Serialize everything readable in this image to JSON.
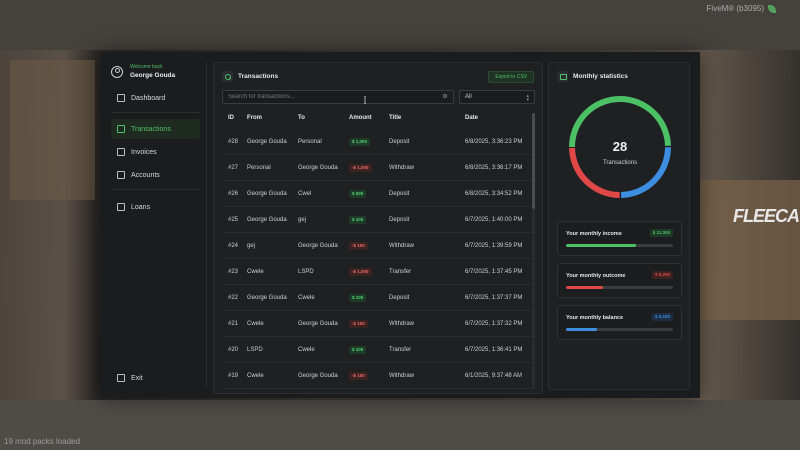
{
  "overlay": {
    "top_right": "FiveM® (b3095)",
    "bottom_left": "19 mod packs loaded",
    "fleeca_logo": "FLEECA"
  },
  "user": {
    "welcome": "Welcome back",
    "name": "George Gouda"
  },
  "nav": {
    "dashboard": "Dashboard",
    "transactions": "Transactions",
    "invoices": "Invoices",
    "accounts": "Accounts",
    "loans": "Loans",
    "exit": "Exit"
  },
  "transactions": {
    "title": "Transactions",
    "export_label": "Export to CSV",
    "search_placeholder": "Search for transactions...",
    "filter_value": "All",
    "columns": [
      "ID",
      "From",
      "To",
      "Amount",
      "Title",
      "Date"
    ],
    "rows": [
      {
        "id": "#28",
        "from": "George Gouda",
        "to": "Personal",
        "amount": "$ 1,000",
        "type": "pos",
        "title": "Deposit",
        "date": "6/8/2025, 3:36:23 PM"
      },
      {
        "id": "#27",
        "from": "Personal",
        "to": "George Gouda",
        "amount": "-$ 1,000",
        "type": "neg",
        "title": "Withdraw",
        "date": "6/8/2025, 3:36:17 PM"
      },
      {
        "id": "#26",
        "from": "George Gouda",
        "to": "Cwel",
        "amount": "$ 500",
        "type": "pos",
        "title": "Deposit",
        "date": "6/8/2025, 3:34:52 PM"
      },
      {
        "id": "#25",
        "from": "George Gouda",
        "to": "gej",
        "amount": "$ 100",
        "type": "pos",
        "title": "Deposit",
        "date": "6/7/2025, 1:40:00 PM"
      },
      {
        "id": "#24",
        "from": "gej",
        "to": "George Gouda",
        "amount": "-$ 100",
        "type": "neg",
        "title": "Withdraw",
        "date": "6/7/2025, 1:39:59 PM"
      },
      {
        "id": "#23",
        "from": "Cwele",
        "to": "LSPD",
        "amount": "-$ 1,000",
        "type": "neg",
        "title": "Transfer",
        "date": "6/7/2025, 1:37:45 PM"
      },
      {
        "id": "#22",
        "from": "George Gouda",
        "to": "Cwele",
        "amount": "$ 100",
        "type": "pos",
        "title": "Deposit",
        "date": "6/7/2025, 1:37:37 PM"
      },
      {
        "id": "#21",
        "from": "Cwele",
        "to": "George Gouda",
        "amount": "-$ 100",
        "type": "neg",
        "title": "Withdraw",
        "date": "6/7/2025, 1:37:32 PM"
      },
      {
        "id": "#20",
        "from": "LSPD",
        "to": "Cwele",
        "amount": "$ 100",
        "type": "pos",
        "title": "Transfer",
        "date": "6/7/2025, 1:36:41 PM"
      },
      {
        "id": "#19",
        "from": "Cwele",
        "to": "George Gouda",
        "amount": "-$ 100",
        "type": "neg",
        "title": "Withdraw",
        "date": "6/1/2025, 9:37:48 AM"
      }
    ]
  },
  "stats": {
    "title": "Monthly statistics",
    "count": "28",
    "count_label": "Transactions",
    "donut_segments": [
      {
        "fraction": 0.5,
        "color": "#4cc064"
      },
      {
        "fraction": 0.25,
        "color": "#3d8ee0"
      },
      {
        "fraction": 0.25,
        "color": "#e04848"
      }
    ],
    "income": {
      "label": "Your monthly income",
      "value": "$ 11,300",
      "fill": 0.65,
      "color": "#4cc064",
      "badge_bg": "#1d3b26"
    },
    "outcome": {
      "label": "Your monthly outcome",
      "value": "$ 6,200",
      "fill": 0.35,
      "color": "#e04848",
      "badge_bg": "#3d2222"
    },
    "balance": {
      "label": "Your monthly balance",
      "value": "$ 5,100",
      "fill": 0.29,
      "color": "#3d8ee0",
      "badge_bg": "#1d2d42"
    }
  }
}
